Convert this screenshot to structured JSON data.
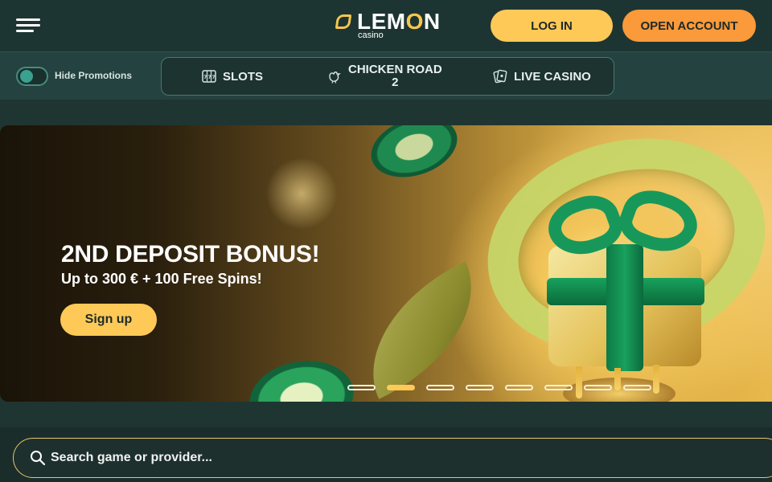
{
  "header": {
    "logo_text": "LEMON",
    "logo_sub": "casino",
    "login_label": "LOG IN",
    "open_account_label": "OPEN ACCOUNT"
  },
  "subnav": {
    "toggle_label": "Hide Promotions",
    "toggle_on": true,
    "items": [
      {
        "label": "SLOTS",
        "icon": "slot-machine-icon"
      },
      {
        "label_line1": "CHICKEN ROAD",
        "label_line2": "2",
        "icon": "chicken-icon"
      },
      {
        "label": "LIVE CASINO",
        "icon": "cards-icon"
      }
    ]
  },
  "banner": {
    "title": "2ND DEPOSIT BONUS!",
    "subtitle": "Up to 300 € + 100 Free Spins!",
    "cta_label": "Sign up",
    "slides_total": 8,
    "active_slide": 2
  },
  "search": {
    "placeholder": "Search game or provider...",
    "icon": "search-icon"
  },
  "colors": {
    "accent_yellow": "#ffc957",
    "accent_orange": "#fa9a3a",
    "background": "#1f3532"
  }
}
